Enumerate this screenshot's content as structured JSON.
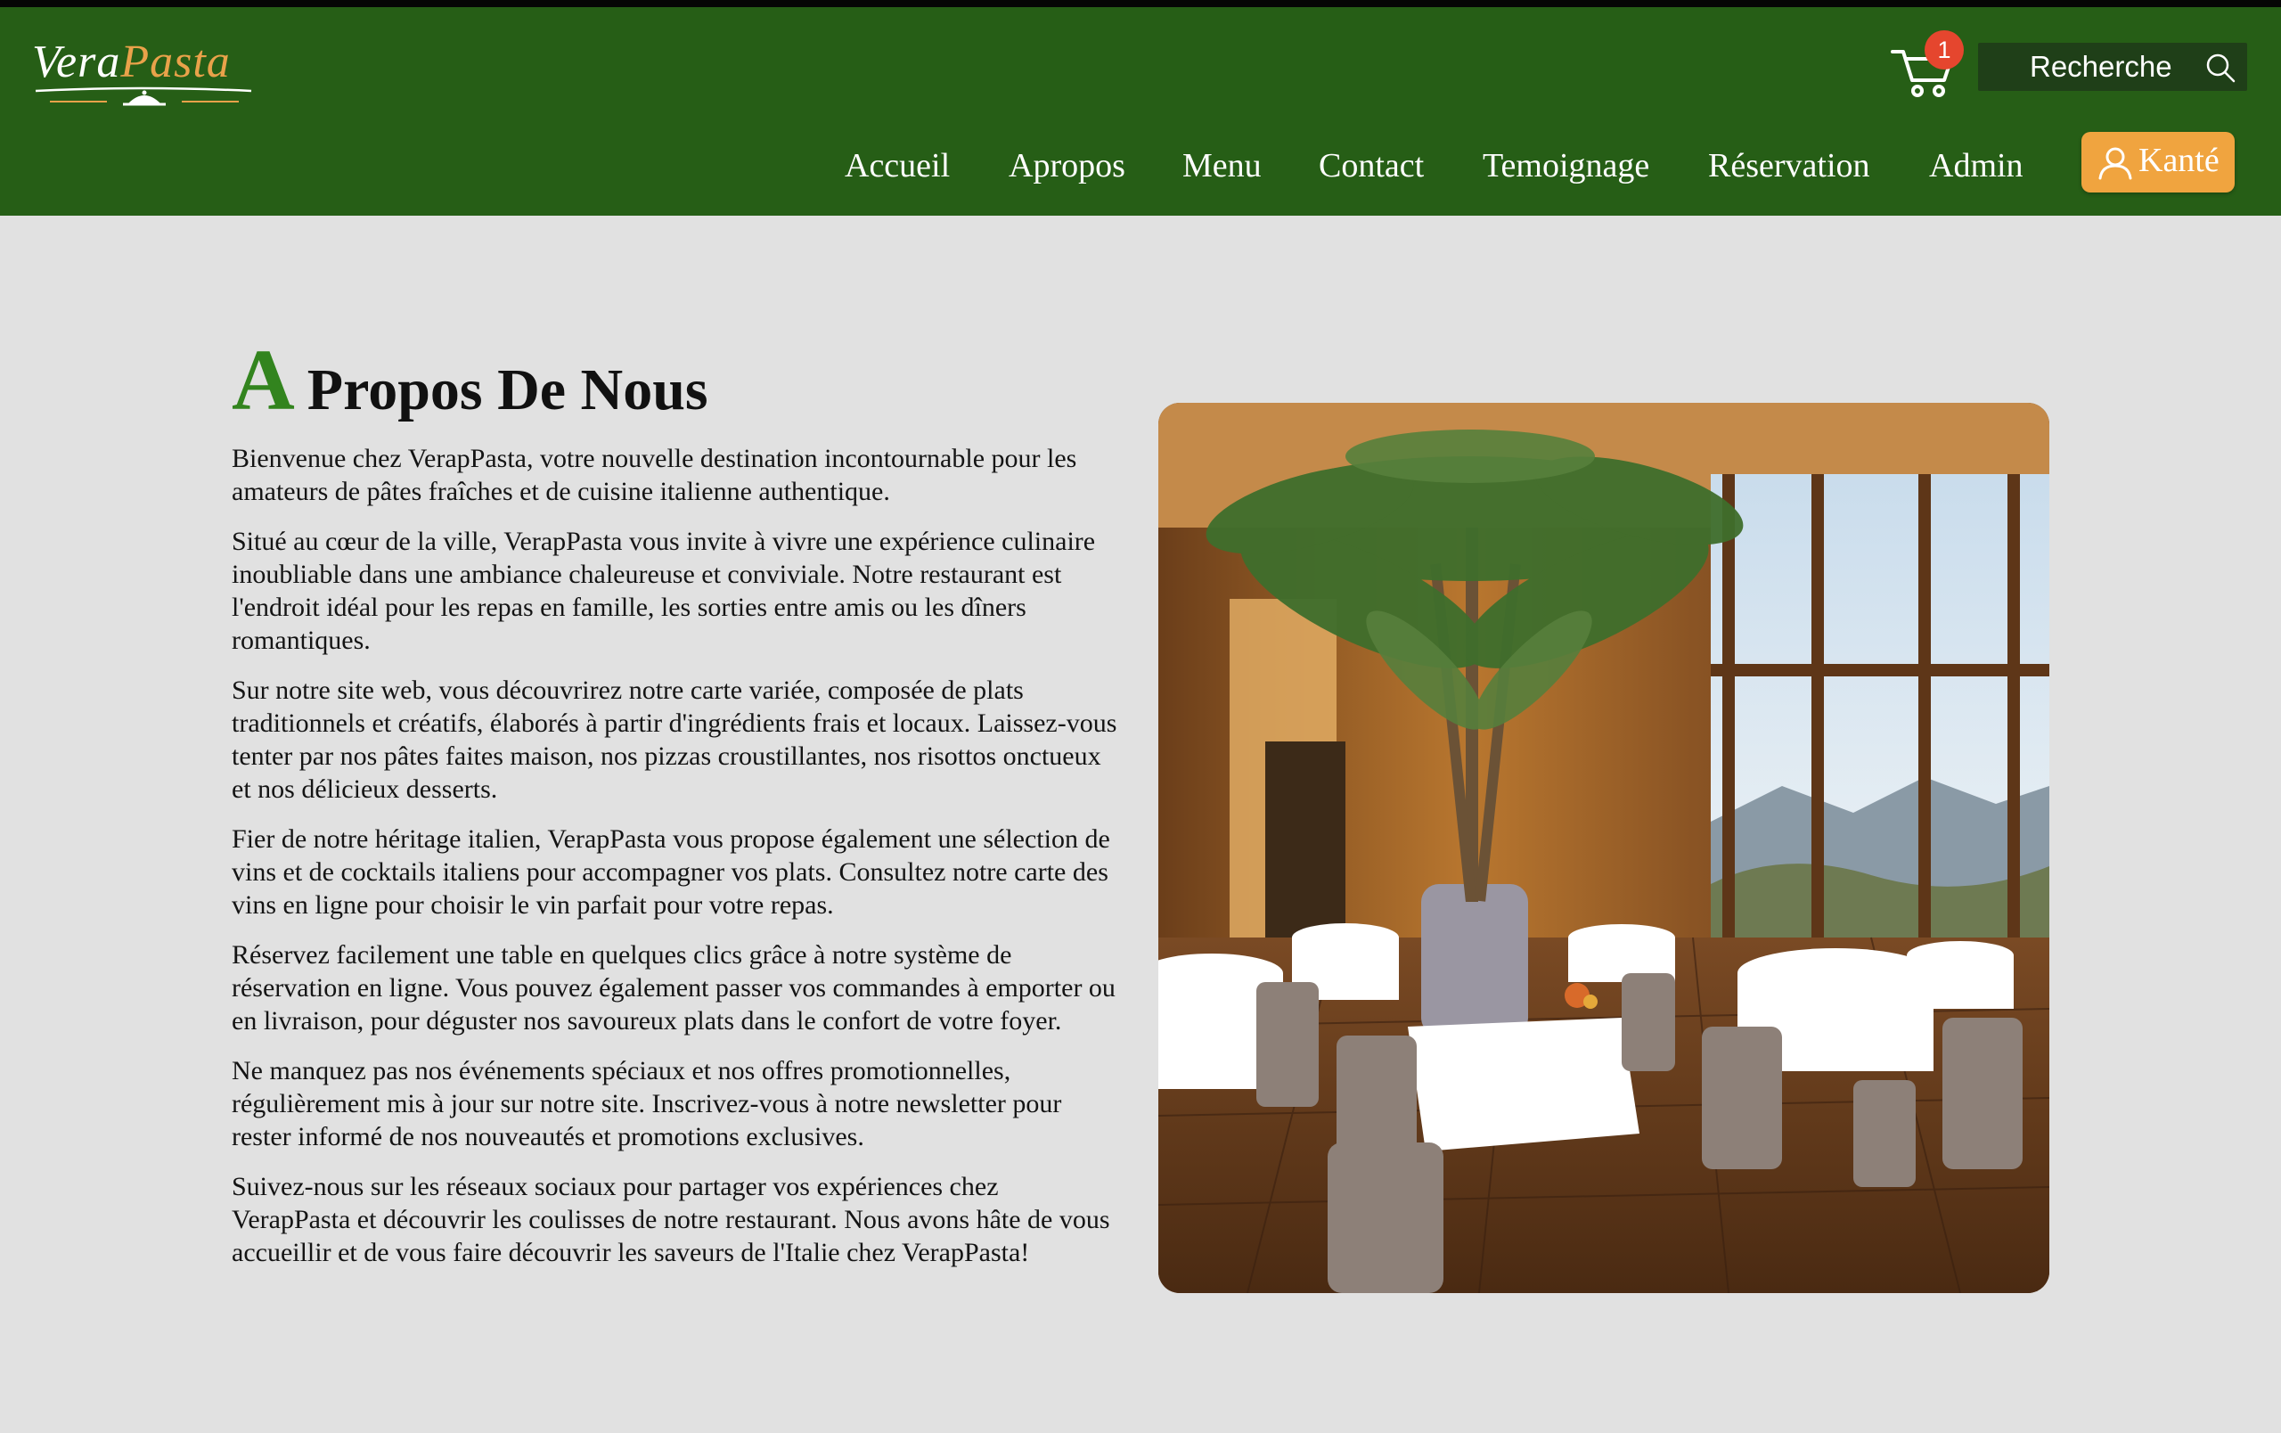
{
  "header": {
    "logo": {
      "part1": "Vera",
      "part2": "Pasta"
    },
    "cart": {
      "icon": "cart-icon",
      "count": "1"
    },
    "search": {
      "label": "Recherche",
      "icon": "search-icon"
    },
    "nav": [
      {
        "label": "Accueil"
      },
      {
        "label": "Apropos"
      },
      {
        "label": "Menu"
      },
      {
        "label": "Contact"
      },
      {
        "label": "Temoignage"
      },
      {
        "label": "Réservation"
      },
      {
        "label": "Admin"
      }
    ],
    "user_button": {
      "label": "Kanté",
      "icon": "user-icon"
    }
  },
  "main": {
    "title_initial": "A",
    "title_rest": "Propos De Nous",
    "paragraphs": [
      "Bienvenue chez VerapPasta, votre nouvelle destination incontournable pour les amateurs de pâtes fraîches et de cuisine italienne authentique.",
      "Situé au cœur de la ville, VerapPasta vous invite à vivre une expérience culinaire inoubliable dans une ambiance chaleureuse et conviviale. Notre restaurant est l'endroit idéal pour les repas en famille, les sorties entre amis ou les dîners romantiques.",
      "Sur notre site web, vous découvrirez notre carte variée, composée de plats traditionnels et créatifs, élaborés à partir d'ingrédients frais et locaux. Laissez-vous tenter par nos pâtes faites maison, nos pizzas croustillantes, nos risottos onctueux et nos délicieux desserts.",
      "Fier de notre héritage italien, VerapPasta vous propose également une sélection de vins et de cocktails italiens pour accompagner vos plats. Consultez notre carte des vins en ligne pour choisir le vin parfait pour votre repas.",
      "Réservez facilement une table en quelques clics grâce à notre système de réservation en ligne. Vous pouvez également passer vos commandes à emporter ou en livraison, pour déguster nos savoureux plats dans le confort de votre foyer.",
      "Ne manquez pas nos événements spéciaux et nos offres promotionnelles, régulièrement mis à jour sur notre site. Inscrivez-vous à notre newsletter pour rester informé de nos nouveautés et promotions exclusives.",
      "Suivez-nous sur les réseaux sociaux pour partager vos expériences chez VerapPasta et découvrir les coulisses de notre restaurant. Nous avons hâte de vous accueillir et de vous faire découvrir les saveurs de l'Italie chez VerapPasta!"
    ]
  },
  "colors": {
    "header_bg": "#265e16",
    "accent_green": "#32841e",
    "user_button_bg": "#f0a43f",
    "badge_red": "#e5462e",
    "page_bg": "#e1e1e1"
  }
}
